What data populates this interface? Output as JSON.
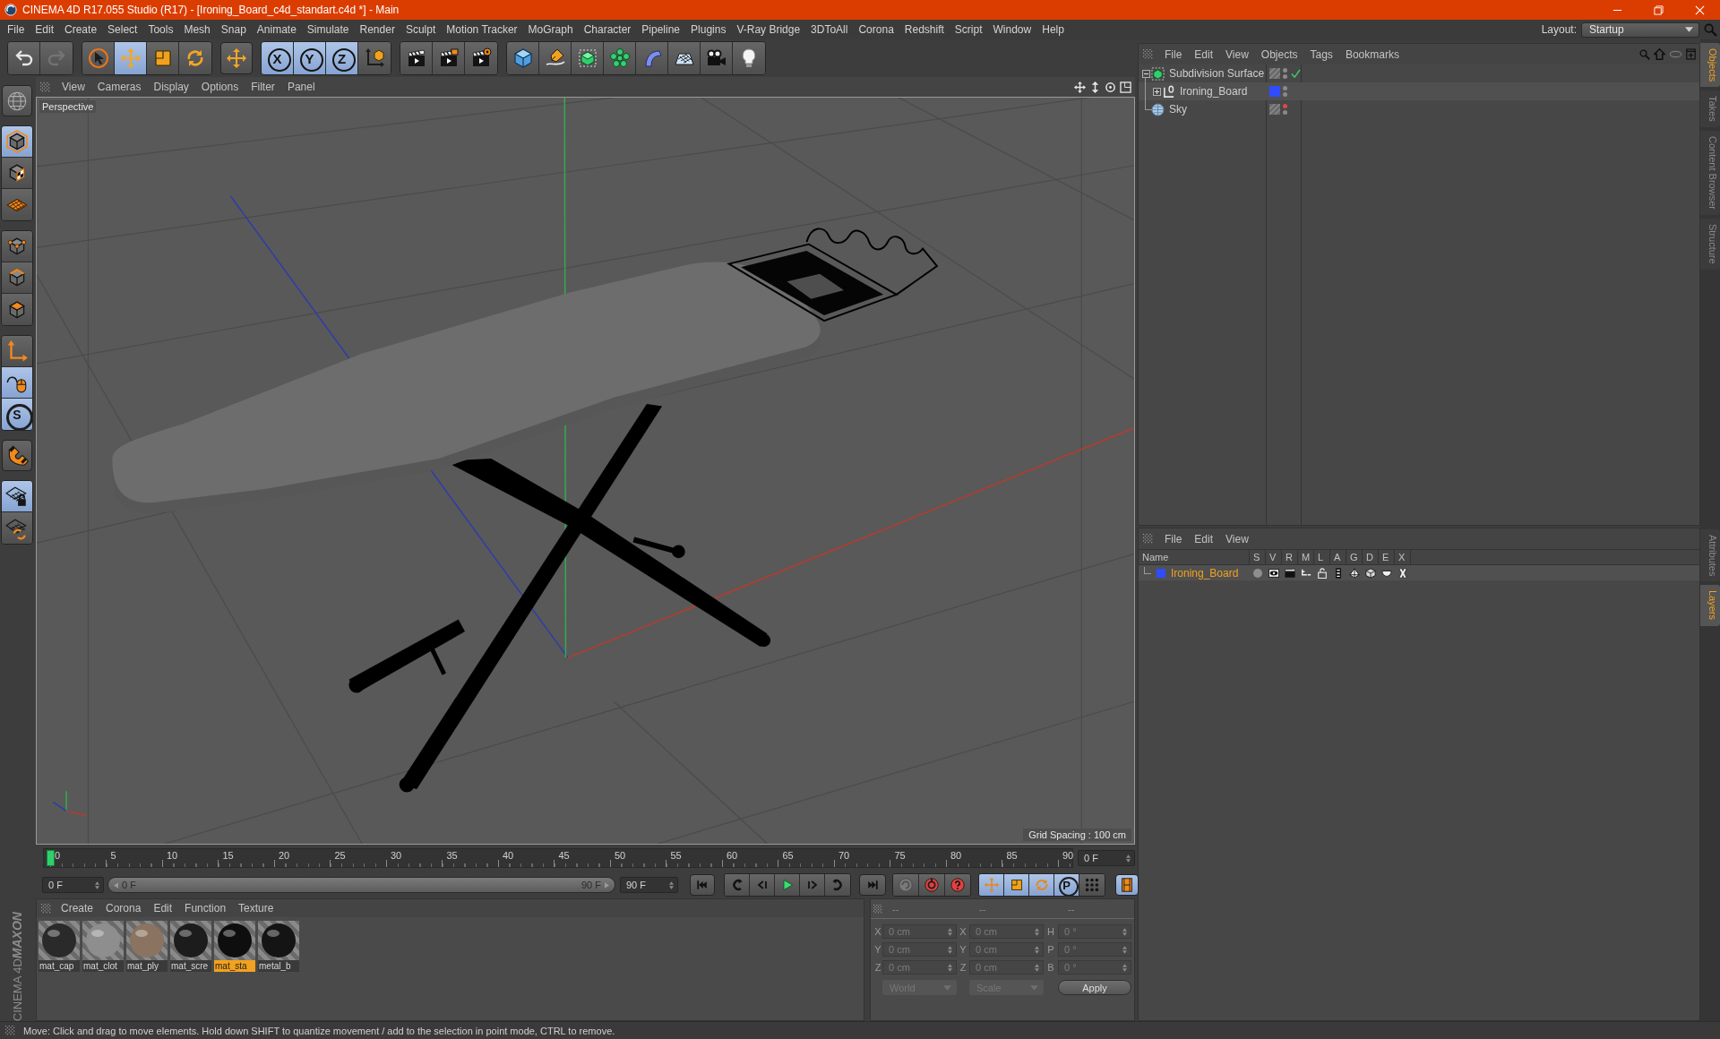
{
  "window": {
    "title": "CINEMA 4D R17.055 Studio (R17) - [Ironing_Board_c4d_standart.c4d *] - Main"
  },
  "menu": [
    "File",
    "Edit",
    "Create",
    "Select",
    "Tools",
    "Mesh",
    "Snap",
    "Animate",
    "Simulate",
    "Render",
    "Sculpt",
    "Motion Tracker",
    "MoGraph",
    "Character",
    "Pipeline",
    "Plugins",
    "V-Ray Bridge",
    "3DToAll",
    "Corona",
    "Redshift",
    "Script",
    "Window",
    "Help"
  ],
  "layout": {
    "label": "Layout:",
    "value": "Startup"
  },
  "toolbar": {
    "groups": [
      {
        "buttons": [
          {
            "selected": false,
            "disabled": false
          },
          {
            "selected": false,
            "disabled": true
          }
        ]
      },
      {
        "buttons": [
          {
            "selected": false,
            "disabled": false
          },
          {
            "selected": true,
            "disabled": false
          },
          {
            "selected": false,
            "disabled": false
          },
          {
            "selected": false,
            "disabled": false
          }
        ]
      },
      {
        "buttons": [
          {
            "selected": false,
            "disabled": false
          }
        ]
      },
      {
        "buttons": [
          {
            "label": "X",
            "selected": true,
            "disabled": false
          },
          {
            "label": "Y",
            "selected": true,
            "disabled": false
          },
          {
            "label": "Z",
            "selected": true,
            "disabled": false
          },
          {
            "selected": false,
            "disabled": false
          }
        ]
      },
      {
        "buttons": [
          {
            "selected": false,
            "disabled": false
          },
          {
            "selected": false,
            "disabled": false
          },
          {
            "selected": false,
            "disabled": false
          }
        ]
      },
      {
        "buttons": [
          {
            "selected": false,
            "disabled": false
          },
          {
            "selected": false,
            "disabled": false
          },
          {
            "selected": false,
            "disabled": false
          },
          {
            "selected": false,
            "disabled": false
          },
          {
            "selected": false,
            "disabled": false
          },
          {
            "selected": false,
            "disabled": false
          },
          {
            "selected": false,
            "disabled": false
          },
          {
            "selected": false,
            "disabled": false
          }
        ]
      }
    ]
  },
  "left_toolbar": {
    "groups": [
      {
        "buttons": [
          {
            "selected": false
          }
        ]
      },
      {
        "buttons": [
          {
            "selected": true
          },
          {
            "selected": false
          },
          {
            "selected": false
          }
        ]
      },
      {
        "buttons": [
          {
            "selected": false
          },
          {
            "selected": false
          },
          {
            "selected": false
          }
        ]
      },
      {
        "buttons": [
          {
            "selected": false
          },
          {
            "selected": true
          },
          {
            "label": "S",
            "selected": true
          }
        ]
      },
      {
        "buttons": [
          {
            "selected": false
          }
        ]
      },
      {
        "buttons": [
          {
            "selected": true
          },
          {
            "selected": false
          }
        ]
      }
    ]
  },
  "logo": {
    "brand": "MAXON",
    "product": "CINEMA 4D"
  },
  "viewport": {
    "menu": [
      "View",
      "Cameras",
      "Display",
      "Options",
      "Filter",
      "Panel"
    ],
    "camera": "Perspective",
    "grid_spacing": "Grid Spacing : 100 cm"
  },
  "timeline": {
    "ticks": [
      "0",
      "5",
      "10",
      "15",
      "20",
      "25",
      "30",
      "35",
      "40",
      "45",
      "50",
      "55",
      "60",
      "65",
      "70",
      "75",
      "80",
      "85",
      "90"
    ],
    "level": 0,
    "current_frame": "0 F",
    "start": "0 F",
    "range": {
      "start": "0 F",
      "end": "90 F",
      "level": 1
    },
    "end": "90 F",
    "key_buttons": [
      {
        "selected": true
      },
      {
        "selected": true
      },
      {
        "selected": true
      },
      {
        "label": "P",
        "selected": true
      },
      {
        "selected": false
      }
    ],
    "timeline_button": {
      "selected": true
    }
  },
  "materials": {
    "menu": [
      "Create",
      "Corona",
      "Edit",
      "Function",
      "Texture"
    ],
    "items": [
      {
        "name": "mat_cap",
        "color": "#2a2a2a",
        "selected": false
      },
      {
        "name": "mat_clot",
        "color": "#8e8e8e",
        "selected": false
      },
      {
        "name": "mat_ply",
        "color": "#8a7361",
        "selected": false
      },
      {
        "name": "mat_scre",
        "color": "#1c1c1c",
        "selected": false
      },
      {
        "name": "mat_sta",
        "color": "#0e0e0e",
        "selected": true
      },
      {
        "name": "metal_b",
        "color": "#141414",
        "selected": false
      }
    ]
  },
  "coordinates": {
    "headers": [
      "--",
      "--",
      "--"
    ],
    "rows": [
      {
        "cells": [
          {
            "axis": "X",
            "value": "0 cm",
            "disabled": true
          },
          {
            "axis": "X",
            "value": "0 cm",
            "disabled": true
          },
          {
            "axis": "H",
            "value": "0 °",
            "disabled": true
          }
        ]
      },
      {
        "cells": [
          {
            "axis": "Y",
            "value": "0 cm",
            "disabled": true
          },
          {
            "axis": "Y",
            "value": "0 cm",
            "disabled": true
          },
          {
            "axis": "P",
            "value": "0 °",
            "disabled": true
          }
        ]
      },
      {
        "cells": [
          {
            "axis": "Z",
            "value": "0 cm",
            "disabled": true
          },
          {
            "axis": "Z",
            "value": "0 cm",
            "disabled": true
          },
          {
            "axis": "B",
            "value": "0 °",
            "disabled": true
          }
        ]
      }
    ],
    "dropdowns": [
      {
        "value": "World",
        "disabled": true
      },
      {
        "value": "Scale",
        "disabled": true
      }
    ],
    "apply": "Apply"
  },
  "object_manager": {
    "menu": [
      "File",
      "Edit",
      "View",
      "Objects",
      "Tags",
      "Bookmarks"
    ],
    "objects": [
      {
        "name": "Subdivision Surface",
        "kind": "subdivision",
        "expanded": true,
        "hidden_in_editor": false,
        "hidden_in_render": false,
        "enabled": true,
        "children": [
          {
            "name": "Ironing_Board",
            "kind": "null",
            "expanded": false,
            "color": "#2f4cff",
            "hidden_in_editor": false,
            "hidden_in_render": false
          }
        ]
      },
      {
        "name": "Sky",
        "kind": "sky",
        "hidden_in_editor": true,
        "hidden_in_render": false
      }
    ]
  },
  "side_tabs_top": [
    {
      "label": "Objects",
      "selected": true
    },
    {
      "label": "Takes",
      "selected": false
    },
    {
      "label": "Content Browser",
      "selected": false
    },
    {
      "label": "Structure",
      "selected": false
    }
  ],
  "layer_manager": {
    "menu": [
      "File",
      "Edit",
      "View"
    ],
    "columns": [
      "Name",
      "S",
      "V",
      "R",
      "M",
      "L",
      "A",
      "G",
      "D",
      "E",
      "X"
    ],
    "rows": [
      {
        "name": "Ironing_Board",
        "color": "#2f4cff",
        "selected": true
      }
    ]
  },
  "side_tabs_bottom": [
    {
      "label": "Attributes",
      "selected": false
    },
    {
      "label": "Layers",
      "selected": true
    }
  ],
  "status_bar": "Move: Click and drag to move elements. Hold down SHIFT to quantize movement / add to the selection in point mode, CTRL to remove."
}
